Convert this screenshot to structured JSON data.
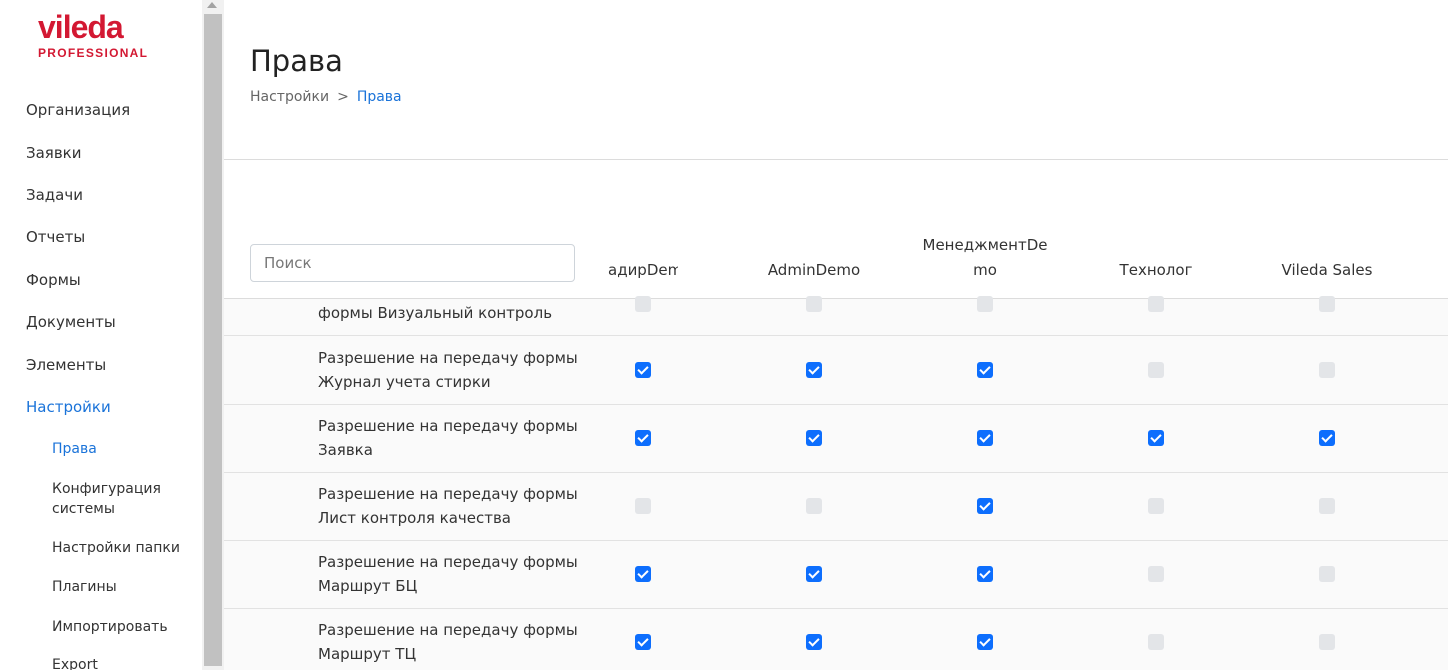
{
  "logo": {
    "brand": "vileda",
    "sub": "PROFESSIONAL"
  },
  "sidebar": {
    "items": [
      {
        "label": "Организация"
      },
      {
        "label": "Заявки"
      },
      {
        "label": "Задачи"
      },
      {
        "label": "Отчеты"
      },
      {
        "label": "Формы"
      },
      {
        "label": "Документы"
      },
      {
        "label": "Элементы"
      },
      {
        "label": "Настройки"
      }
    ],
    "sub_items": [
      {
        "label": "Права"
      },
      {
        "label": "Конфигурация системы"
      },
      {
        "label": "Настройки папки"
      },
      {
        "label": "Плагины"
      },
      {
        "label": "Импортировать"
      },
      {
        "label": "Export"
      }
    ]
  },
  "page": {
    "title": "Права",
    "breadcrumb": {
      "parent": "Настройки",
      "separator": ">",
      "current": "Права"
    }
  },
  "search": {
    "placeholder": "Поиск",
    "value": ""
  },
  "columns": [
    {
      "label": "адирDemo"
    },
    {
      "label": "AdminDemo"
    },
    {
      "label": "МенеджментDe mo"
    },
    {
      "label": "Технолог"
    },
    {
      "label": "Vileda Sales"
    }
  ],
  "rows": [
    {
      "label": "формы Визуальный контроль",
      "checks": [
        false,
        false,
        false,
        false,
        false
      ]
    },
    {
      "label": "Разрешение на передачу формы Журнал учета стирки",
      "checks": [
        true,
        true,
        true,
        false,
        false
      ]
    },
    {
      "label": "Разрешение на передачу формы Заявка",
      "checks": [
        true,
        true,
        true,
        true,
        true
      ]
    },
    {
      "label": "Разрешение на передачу формы Лист контроля качества",
      "checks": [
        false,
        false,
        true,
        false,
        false
      ]
    },
    {
      "label": "Разрешение на передачу формы Маршрут БЦ",
      "checks": [
        true,
        true,
        true,
        false,
        false
      ]
    },
    {
      "label": "Разрешение на передачу формы Маршрут ТЦ",
      "checks": [
        true,
        true,
        true,
        false,
        false
      ]
    }
  ],
  "colors": {
    "accent": "#1a73d9",
    "brand": "#d31832",
    "checkbox_on": "#0d6efd",
    "checkbox_off": "#e3e5e8"
  }
}
